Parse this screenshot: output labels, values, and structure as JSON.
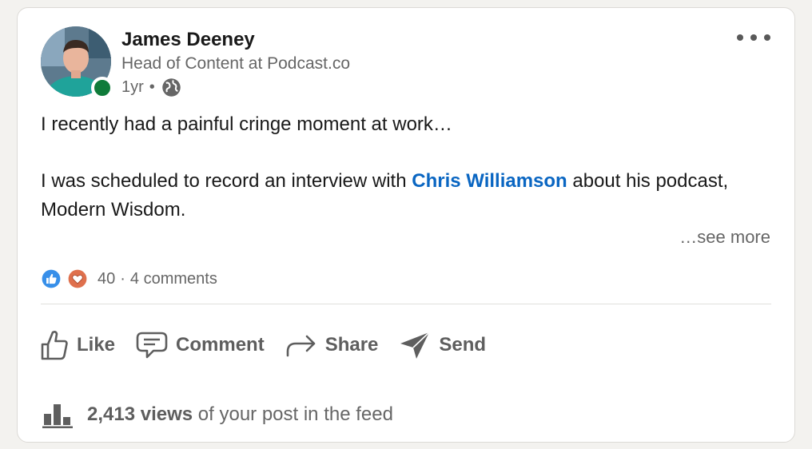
{
  "author": {
    "name": "James Deeney",
    "headline": "Head of Content at Podcast.co",
    "time": "1yr",
    "separator": "•",
    "online_color": "#0f7b3a"
  },
  "post": {
    "line1": "I recently had a painful cringe moment at work…",
    "line2_prefix": "I was scheduled to record an interview with ",
    "mention": "Chris Williamson",
    "line2_suffix": " about his podcast, Modern Wisdom.",
    "see_more": "…see more"
  },
  "social": {
    "reaction_icons": [
      "like-icon",
      "love-icon"
    ],
    "reaction_count": "40",
    "dot": "·",
    "comments": "4 comments"
  },
  "actions": {
    "like": "Like",
    "comment": "Comment",
    "share": "Share",
    "send": "Send"
  },
  "analytics": {
    "views": "2,413 views",
    "suffix": "of your post in the feed"
  },
  "colors": {
    "link": "#0a66c2",
    "like_blue": "#378fe9",
    "love_red": "#df704d"
  }
}
